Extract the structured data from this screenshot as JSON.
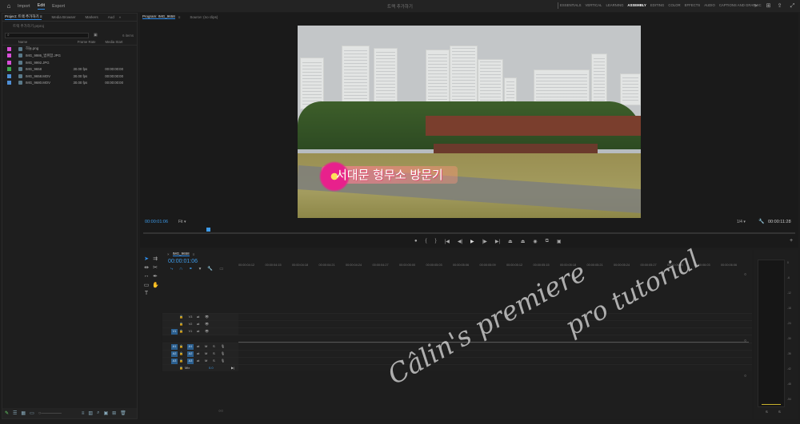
{
  "menu": {
    "home_icon": "home-icon",
    "items": [
      "Import",
      "Edit",
      "Export"
    ],
    "active": "Edit",
    "project_title": "트랙 추가하기"
  },
  "workspaces": {
    "items": [
      "ESSENTIALS",
      "VERTICAL",
      "LEARNING",
      "ASSEMBLY",
      "EDITING",
      "COLOR",
      "EFFECTS",
      "AUDIO",
      "CAPTIONS AND GRAPHIC"
    ],
    "active": "ASSEMBLY"
  },
  "project_panel": {
    "tabs": [
      "Project: 트랙 추가하기 ≡",
      "Media Browser",
      "Markers",
      "Aud"
    ],
    "file": "트랙 추가하기.prproj",
    "items_count": "6 items",
    "columns": {
      "name": "Name",
      "frame_rate": "Frame Rate",
      "media_start": "Media Start"
    },
    "rows": [
      {
        "color": "#d84fd8",
        "name": "하늘.png",
        "fr": "",
        "ms": ""
      },
      {
        "color": "#d84fd8",
        "name": "IMG_9986_범위함.JPG",
        "fr": "",
        "ms": ""
      },
      {
        "color": "#d84fd8",
        "name": "IMG_9992.JPG",
        "fr": "",
        "ms": ""
      },
      {
        "color": "#3fa84f",
        "name": "IMG_9658",
        "fr": "30.00 fps",
        "ms": "00:00:00:00"
      },
      {
        "color": "#4e8fd6",
        "name": "IMG_9658.MOV",
        "fr": "30.00 fps",
        "ms": "00:00:00:00"
      },
      {
        "color": "#4e8fd6",
        "name": "IMG_9680.MOV",
        "fr": "30.00 fps",
        "ms": "00:00:00:00"
      }
    ]
  },
  "program": {
    "tab_program": "Program: IMG_9658",
    "tab_source": "Source: (no clips)",
    "caption": "서대문 형무소 방문기",
    "timecode_current": "00:00:01:06",
    "fit": "Fit",
    "quality": "1/4",
    "timecode_duration": "00:00:11:28"
  },
  "timeline": {
    "tab": "IMG_9658",
    "timecode": "00:00:01:06",
    "ruler": [
      "00:00:04:12",
      "00:00:04:15",
      "00:00:04:18",
      "00:00:04:21",
      "00:00:04:24",
      "00:00:04:27",
      "00:00:05:00",
      "00:00:05:03",
      "00:00:05:06",
      "00:00:05:09",
      "00:00:05:12",
      "00:00:05:15",
      "00:00:05:18",
      "00:00:05:21",
      "00:00:05:24",
      "00:00:05:27",
      "00:00:06:00",
      "00:00:06:03",
      "00:00:06:06"
    ],
    "video_tracks": [
      "V3",
      "V2",
      "V1"
    ],
    "audio_tracks": [
      "A1",
      "A2",
      "A3"
    ],
    "source_patch": {
      "video": "V1",
      "audio": [
        "A1",
        "A2",
        "A3"
      ]
    },
    "mix_label": "Mix",
    "mix_value": "0.0"
  },
  "meter": {
    "db_labels": [
      "0",
      "-6",
      "-12",
      "-18",
      "-24",
      "-30",
      "-36",
      "-42",
      "-48",
      "-54"
    ],
    "bottom": [
      "S",
      "S"
    ]
  },
  "watermark": {
    "line1": "Câlin's premiere",
    "line2": "pro tutorial"
  }
}
